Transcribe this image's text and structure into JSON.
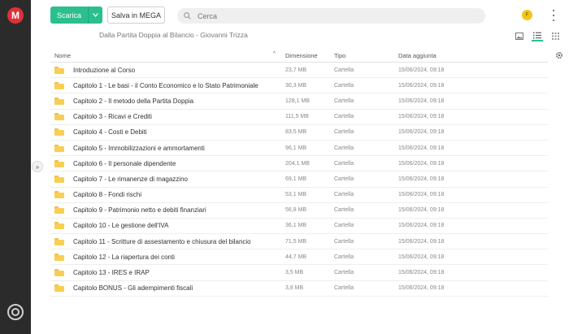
{
  "app": {
    "logo_letter": "M"
  },
  "toolbar": {
    "download_label": "Scarica",
    "save_label": "Salva in MEGA",
    "search_placeholder": "Cerca",
    "avatar_initial": "F"
  },
  "breadcrumb": "Dalla Partita Doppia al Bilancio - Giovanni Trizza",
  "table": {
    "headers": {
      "name": "Nome",
      "size": "Dimensione",
      "type": "Tipo",
      "date": "Data aggiunta"
    },
    "rows": [
      {
        "name": "Introduzione al Corso",
        "size": "23,7 MB",
        "type": "Cartella",
        "date": "15/06/2024, 09:18"
      },
      {
        "name": "Capitolo 1 - Le basi - il Conto Economico e lo Stato Patrimoniale",
        "size": "30,3 MB",
        "type": "Cartella",
        "date": "15/06/2024, 09:18"
      },
      {
        "name": "Capitolo 2 - Il metodo della Partita Doppia",
        "size": "128,1 MB",
        "type": "Cartella",
        "date": "15/06/2024, 09:18"
      },
      {
        "name": "Capitolo 3 - Ricavi e Crediti",
        "size": "111,5 MB",
        "type": "Cartella",
        "date": "15/06/2024, 09:18"
      },
      {
        "name": "Capitolo 4 - Costi e Debiti",
        "size": "83,5 MB",
        "type": "Cartella",
        "date": "15/06/2024, 09:18"
      },
      {
        "name": "Capitolo 5 - Immobilizzazioni e ammortamenti",
        "size": "96,1 MB",
        "type": "Cartella",
        "date": "15/06/2024, 09:18"
      },
      {
        "name": "Capitolo 6 - Il personale dipendente",
        "size": "204,1 MB",
        "type": "Cartella",
        "date": "15/06/2024, 09:18"
      },
      {
        "name": "Capitolo 7 - Le rimanenze di magazzino",
        "size": "69,1 MB",
        "type": "Cartella",
        "date": "15/06/2024, 09:18"
      },
      {
        "name": "Capitolo 8 - Fondi rischi",
        "size": "53,1 MB",
        "type": "Cartella",
        "date": "15/06/2024, 09:18"
      },
      {
        "name": "Capitolo 9 - Patrimonio netto e debiti finanziari",
        "size": "56,8 MB",
        "type": "Cartella",
        "date": "15/06/2024, 09:18"
      },
      {
        "name": "Capitolo 10 - Le gestione dell'IVA",
        "size": "36,1 MB",
        "type": "Cartella",
        "date": "15/06/2024, 09:18"
      },
      {
        "name": "Capitolo 11 - Scritture di assestamento e chiusura del bilancio",
        "size": "71,5 MB",
        "type": "Cartella",
        "date": "15/06/2024, 09:18"
      },
      {
        "name": "Capitolo 12 - La riapertura dei conti",
        "size": "44,7 MB",
        "type": "Cartella",
        "date": "15/06/2024, 09:18"
      },
      {
        "name": "Capitolo 13 - IRES e IRAP",
        "size": "3,5 MB",
        "type": "Cartella",
        "date": "15/06/2024, 09:18"
      },
      {
        "name": "Capitolo BONUS - Gli adempimenti fiscali",
        "size": "3,8 MB",
        "type": "Cartella",
        "date": "15/06/2024, 09:18"
      }
    ]
  },
  "colors": {
    "accent": "#2bbf8f",
    "brand": "#e0303a",
    "folder": "#f8cf55",
    "sidebar": "#2b2b2b"
  }
}
